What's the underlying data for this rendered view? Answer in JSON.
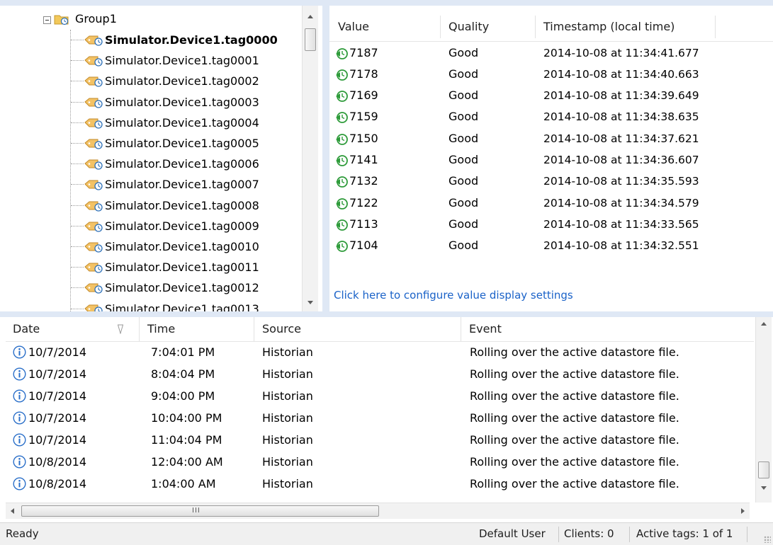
{
  "tree": {
    "root_label": "Group1",
    "items": [
      {
        "label": "Simulator.Device1.tag0000",
        "selected": true
      },
      {
        "label": "Simulator.Device1.tag0001"
      },
      {
        "label": "Simulator.Device1.tag0002"
      },
      {
        "label": "Simulator.Device1.tag0003"
      },
      {
        "label": "Simulator.Device1.tag0004"
      },
      {
        "label": "Simulator.Device1.tag0005"
      },
      {
        "label": "Simulator.Device1.tag0006"
      },
      {
        "label": "Simulator.Device1.tag0007"
      },
      {
        "label": "Simulator.Device1.tag0008"
      },
      {
        "label": "Simulator.Device1.tag0009"
      },
      {
        "label": "Simulator.Device1.tag0010"
      },
      {
        "label": "Simulator.Device1.tag0011"
      },
      {
        "label": "Simulator.Device1.tag0012"
      },
      {
        "label": "Simulator.Device1.tag0013"
      }
    ]
  },
  "values": {
    "columns": {
      "value": "Value",
      "quality": "Quality",
      "timestamp": "Timestamp (local time)"
    },
    "rows": [
      {
        "value": "7187",
        "quality": "Good",
        "timestamp": "2014-10-08 at 11:34:41.677"
      },
      {
        "value": "7178",
        "quality": "Good",
        "timestamp": "2014-10-08 at 11:34:40.663"
      },
      {
        "value": "7169",
        "quality": "Good",
        "timestamp": "2014-10-08 at 11:34:39.649"
      },
      {
        "value": "7159",
        "quality": "Good",
        "timestamp": "2014-10-08 at 11:34:38.635"
      },
      {
        "value": "7150",
        "quality": "Good",
        "timestamp": "2014-10-08 at 11:34:37.621"
      },
      {
        "value": "7141",
        "quality": "Good",
        "timestamp": "2014-10-08 at 11:34:36.607"
      },
      {
        "value": "7132",
        "quality": "Good",
        "timestamp": "2014-10-08 at 11:34:35.593"
      },
      {
        "value": "7122",
        "quality": "Good",
        "timestamp": "2014-10-08 at 11:34:34.579"
      },
      {
        "value": "7113",
        "quality": "Good",
        "timestamp": "2014-10-08 at 11:34:33.565"
      },
      {
        "value": "7104",
        "quality": "Good",
        "timestamp": "2014-10-08 at 11:34:32.551"
      }
    ],
    "config_link": "Click here to configure value display settings"
  },
  "log": {
    "columns": {
      "date": "Date",
      "time": "Time",
      "source": "Source",
      "event": "Event"
    },
    "rows": [
      {
        "date": "10/7/2014",
        "time": "7:04:01 PM",
        "source": "Historian",
        "event": "Rolling over the active datastore file."
      },
      {
        "date": "10/7/2014",
        "time": "8:04:04 PM",
        "source": "Historian",
        "event": "Rolling over the active datastore file."
      },
      {
        "date": "10/7/2014",
        "time": "9:04:00 PM",
        "source": "Historian",
        "event": "Rolling over the active datastore file."
      },
      {
        "date": "10/7/2014",
        "time": "10:04:00 PM",
        "source": "Historian",
        "event": "Rolling over the active datastore file."
      },
      {
        "date": "10/7/2014",
        "time": "11:04:04 PM",
        "source": "Historian",
        "event": "Rolling over the active datastore file."
      },
      {
        "date": "10/8/2014",
        "time": "12:04:00 AM",
        "source": "Historian",
        "event": "Rolling over the active datastore file."
      },
      {
        "date": "10/8/2014",
        "time": "1:04:00 AM",
        "source": "Historian",
        "event": "Rolling over the active datastore file."
      }
    ]
  },
  "status": {
    "ready": "Ready",
    "user": "Default User",
    "clients": "Clients: 0",
    "active_tags": "Active tags: 1 of 1"
  },
  "colors": {
    "link": "#1a62c8",
    "splitter": "#dfe8f5",
    "value_icon": "#2e9b3a",
    "info_icon": "#2a6fc9"
  }
}
